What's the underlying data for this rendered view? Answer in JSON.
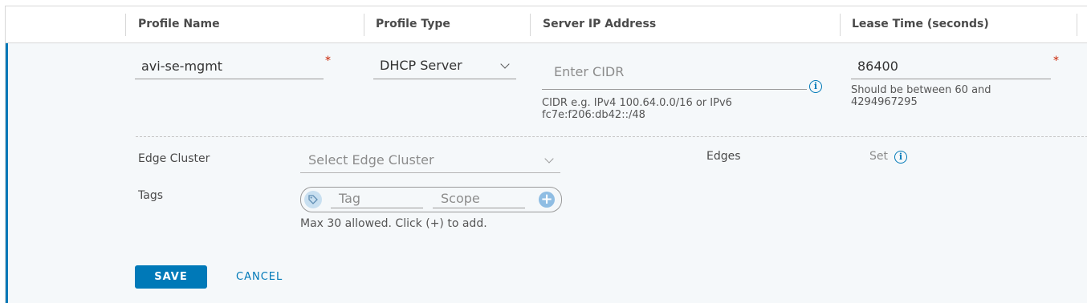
{
  "table": {
    "headers": [
      "Profile Name",
      "Profile Type",
      "Server IP Address",
      "Lease Time (seconds)"
    ]
  },
  "form": {
    "profile_name": {
      "value": "avi-se-mgmt",
      "required_mark": "*"
    },
    "profile_type": {
      "value": "DHCP Server"
    },
    "server_ip": {
      "placeholder": "Enter CIDR",
      "help_line1": "CIDR e.g. IPv4 100.64.0.0/16 or IPv6",
      "help_line2": "fc7e:f206:db42::/48",
      "info_glyph": "i"
    },
    "lease_time": {
      "value": "86400",
      "required_mark": "*",
      "help_line1": "Should be between 60 and",
      "help_line2": "4294967295"
    },
    "edge_cluster": {
      "label": "Edge Cluster",
      "placeholder": "Select Edge Cluster"
    },
    "edges": {
      "label": "Edges",
      "link": "Set",
      "info_glyph": "i"
    },
    "tags": {
      "label": "Tags",
      "tag_placeholder": "Tag",
      "scope_placeholder": "Scope",
      "add_glyph": "+",
      "help": "Max 30 allowed. Click (+) to add."
    }
  },
  "actions": {
    "save": "SAVE",
    "cancel": "CANCEL"
  },
  "colors": {
    "accent": "#0079b8",
    "required": "#c92100",
    "background": "#f5f8fa"
  }
}
